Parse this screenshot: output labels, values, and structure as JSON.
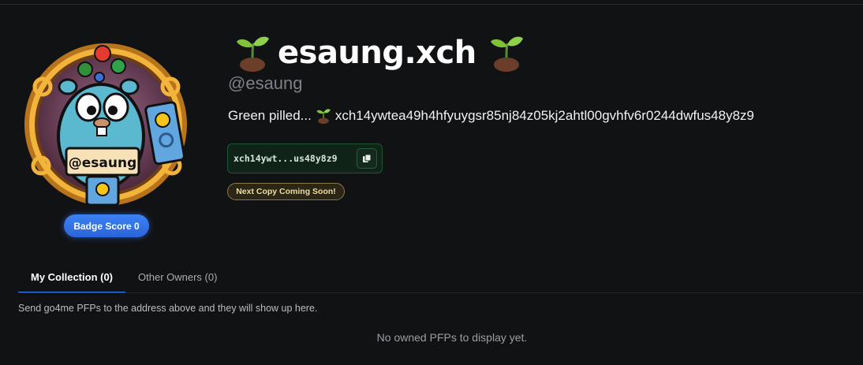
{
  "profile": {
    "display_name": "esaung.xch",
    "handle": "@esaung",
    "bio_prefix": "Green pilled...",
    "bio_address": "xch14ywtea49h4hfyuygsr85nj84z05kj2ahtl00gvhfv6r0244dwfus48y8z9",
    "avatar_label": "@esaung"
  },
  "badge": {
    "label": "Badge Score 0"
  },
  "address": {
    "short": "xch14ywt...us48y8z9"
  },
  "notice": {
    "label": "Next Copy Coming Soon!"
  },
  "tabs": [
    {
      "label": "My Collection (0)",
      "active": true
    },
    {
      "label": "Other Owners (0)",
      "active": false
    }
  ],
  "collection": {
    "hint": "Send go4me PFPs to the address above and they will show up here.",
    "empty_message": "No owned PFPs to display yet."
  },
  "icons": {
    "sprout": "seedling-icon",
    "copy": "copy-icon"
  },
  "colors": {
    "accent": "#3b82f6",
    "address_bg": "#0f2318",
    "notice_border": "#8a7a4a"
  }
}
